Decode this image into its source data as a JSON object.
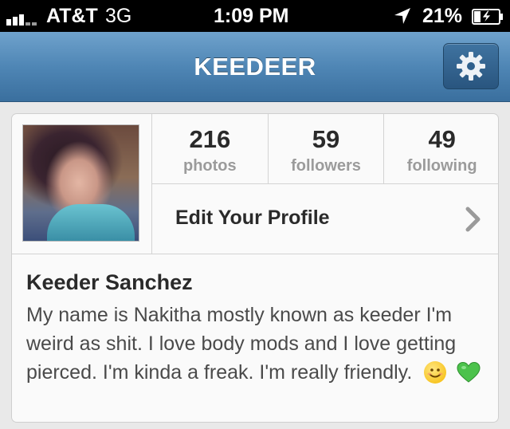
{
  "status_bar": {
    "carrier": "AT&T",
    "network": "3G",
    "time": "1:09 PM",
    "battery": "21%",
    "signal_icon": "signal-bars-icon",
    "location_icon": "location-arrow-icon",
    "battery_icon": "battery-charging-icon"
  },
  "nav": {
    "title": "KEEDEER",
    "settings_icon": "gear-icon",
    "bar_color": "#4f86b5"
  },
  "profile": {
    "stats": [
      {
        "value": "216",
        "label": "photos"
      },
      {
        "value": "59",
        "label": "followers"
      },
      {
        "value": "49",
        "label": "following"
      }
    ],
    "edit_label": "Edit Your Profile",
    "name": "Keeder Sanchez",
    "bio": "My name is Nakitha mostly known as keeder I'm weird as shit. I love body mods and I love getting pierced. I'm kinda a freak. I'm really friendly.",
    "bio_emojis": [
      "smiling-face-emoji",
      "green-heart-emoji"
    ]
  }
}
